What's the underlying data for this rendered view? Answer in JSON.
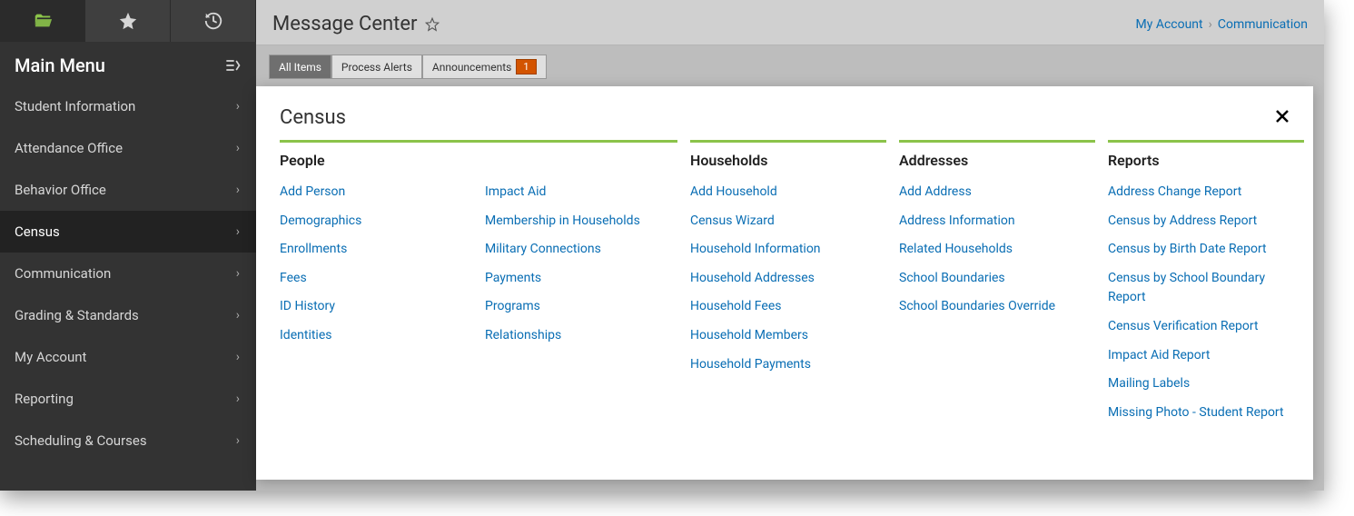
{
  "sidebar": {
    "title": "Main Menu",
    "items": [
      {
        "label": "Student Information"
      },
      {
        "label": "Attendance Office"
      },
      {
        "label": "Behavior Office"
      },
      {
        "label": "Census",
        "active": true
      },
      {
        "label": "Communication"
      },
      {
        "label": "Grading & Standards"
      },
      {
        "label": "My Account"
      },
      {
        "label": "Reporting"
      },
      {
        "label": "Scheduling & Courses"
      }
    ]
  },
  "header": {
    "title": "Message Center",
    "breadcrumb": [
      "My Account",
      "Communication"
    ]
  },
  "tabs": {
    "all_items": "All Items",
    "process_alerts": "Process Alerts",
    "announcements": "Announcements",
    "announcements_badge": "1"
  },
  "flyout": {
    "title": "Census",
    "sections": [
      {
        "title": "People",
        "columns": [
          [
            "Add Person",
            "Demographics",
            "Enrollments",
            "Fees",
            "ID History",
            "Identities"
          ],
          [
            "Impact Aid",
            "Membership in Households",
            "Military Connections",
            "Payments",
            "Programs",
            "Relationships"
          ]
        ]
      },
      {
        "title": "Households",
        "columns": [
          [
            "Add Household",
            "Census Wizard",
            "Household Information",
            "Household Addresses",
            "Household Fees",
            "Household Members",
            "Household Payments"
          ]
        ]
      },
      {
        "title": "Addresses",
        "columns": [
          [
            "Add Address",
            "Address Information",
            "Related Households",
            "School Boundaries",
            "School Boundaries Override"
          ]
        ]
      },
      {
        "title": "Reports",
        "columns": [
          [
            "Address Change Report",
            "Census by Address Report",
            "Census by Birth Date Report",
            "Census by School Boundary Report",
            "Census Verification Report",
            "Impact Aid Report",
            "Mailing Labels",
            "Missing Photo - Student Report"
          ]
        ]
      }
    ]
  }
}
